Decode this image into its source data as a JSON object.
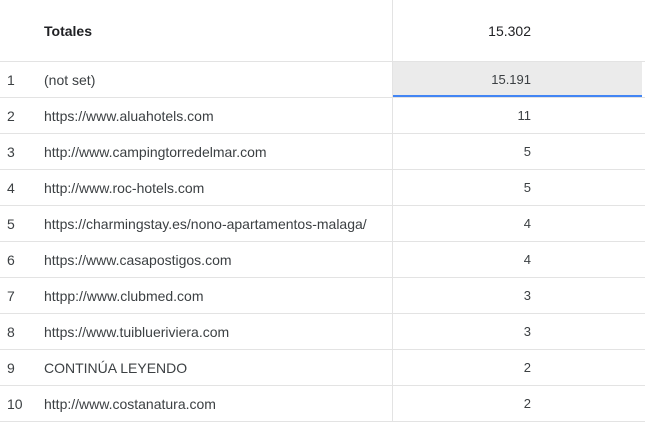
{
  "totals": {
    "label": "Totales",
    "value": "15.302"
  },
  "rows": [
    {
      "index": "1",
      "label": "(not set)",
      "value": "15.191",
      "share": 0.99
    },
    {
      "index": "2",
      "label": "https://www.aluahotels.com",
      "value": "11",
      "share": 0.0007
    },
    {
      "index": "3",
      "label": "http://www.campingtorredelmar.com",
      "value": "5",
      "share": 0.0003
    },
    {
      "index": "4",
      "label": "http://www.roc-hotels.com",
      "value": "5",
      "share": 0.0003
    },
    {
      "index": "5",
      "label": "https://charmingstay.es/nono-apartamentos-malaga/",
      "value": "4",
      "share": 0.0003
    },
    {
      "index": "6",
      "label": "https://www.casapostigos.com",
      "value": "4",
      "share": 0.0003
    },
    {
      "index": "7",
      "label": "httpp://www.clubmed.com",
      "value": "3",
      "share": 0.0002
    },
    {
      "index": "8",
      "label": "https://www.tuiblueriviera.com",
      "value": "3",
      "share": 0.0002
    },
    {
      "index": "9",
      "label": "CONTINÚA LEYENDO",
      "value": "2",
      "share": 0.0001
    },
    {
      "index": "10",
      "label": "http://www.costanatura.com",
      "value": "2",
      "share": 0.0001
    }
  ],
  "colors": {
    "bar": "#ebebeb",
    "bar_underline": "#4285f4",
    "divider": "#e3e3e3"
  }
}
